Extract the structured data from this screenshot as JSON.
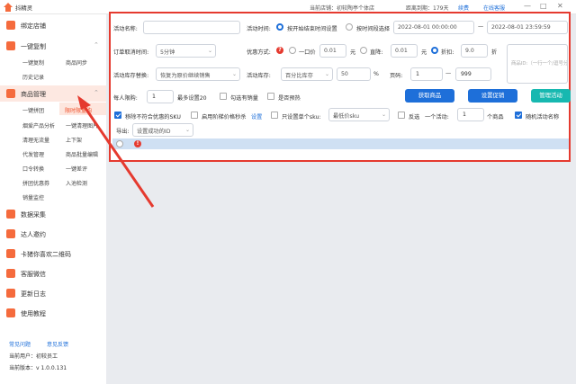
{
  "app": {
    "title": "抖精灵",
    "current_shop_label": "当前店铺：初较陶亭个体店",
    "expire_label": "距离到期：179天",
    "renew_link": "续费",
    "online_service": "在线客服",
    "win_min": "—",
    "win_max": "□",
    "win_close": "✕"
  },
  "sidebar": {
    "bind_shop": "绑定店铺",
    "copy_group": "一键复制",
    "copy_sub": [
      "一键复制",
      "商品同步",
      "历史记录"
    ],
    "goods_group": "商品管理",
    "goods_sub": [
      "一键拼团",
      "限时限量购",
      "烟爱产品分析",
      "一键清理图片",
      "清理无流量",
      "上下架",
      "代发管理",
      "商品批量编辑",
      "口令转换",
      "一键差评",
      "拼团优惠券",
      "入池检测",
      "销量监控"
    ],
    "data_collect": "数据采集",
    "invite": "达人邀约",
    "qrcode": "卡猪你喜欢二维码",
    "service": "客服微信",
    "changelog": "更新日志",
    "tutorial": "使用教程",
    "faq": "常见问题",
    "feedback": "意见反馈",
    "current_user": "当前用户：初较员工",
    "version": "当前版本：v 1.0.0.131"
  },
  "form": {
    "activity_name_label": "活动名称:",
    "activity_name_value": "",
    "activity_time_label": "活动时间:",
    "time_option1": "按开始结束时间设置",
    "time_option2": "按时间段选择",
    "start_time": "2022-08-01 00:00:00",
    "time_sep": "—",
    "end_time": "2022-08-01 23:59:59",
    "order_cancel_label": "订单取消时间:",
    "order_cancel_value": "5分钟",
    "discount_method_label": "优惠方式:",
    "one_price_label": "一口价",
    "one_price_value": "0.01",
    "yuan1": "元",
    "direct_down_label": "直降:",
    "direct_down_value": "0.01",
    "yuan2": "元",
    "discount_label": "折扣:",
    "discount_value": "9.0",
    "zhe": "折",
    "product_id_placeholder": "商品ID:（一行一个/逗号分隔）",
    "stock_label": "活动库存替换:",
    "stock_value": "恢复为原价继续销售",
    "activity_stock_label": "活动库存:",
    "activity_stock_value": "百分比库存",
    "percent_value": "50",
    "percent_unit": "%",
    "page_label": "页码:",
    "page_from": "1",
    "page_to": "999",
    "page_sep": "—",
    "limit_label": "每人限购:",
    "limit_value": "1",
    "limit_hint": "最多设置20",
    "check_sold_label": "勾选有销量",
    "presale_label": "是否预热",
    "btn_get_goods": "获取商品",
    "btn_set_promo": "设置促销",
    "btn_manage": "管理活动",
    "remove_sku_label": "移除不符合优惠的SKU",
    "tiered_label": "启用阶梯价格秒杀",
    "tiered_setting": "设置",
    "single_sku_label": "只设置单个sku:",
    "single_sku_value": "最低价sku",
    "invert_label": "反选",
    "per_activity_label": "一个活动:",
    "per_activity_value": "1",
    "per_activity_unit": "个商品",
    "random_name_label": "随机活动名称",
    "export_label": "导出:",
    "export_value": "设置成功的ID"
  },
  "colors": {
    "accent": "#1e6fd9",
    "brand": "#f56b3d",
    "highlight_border": "#e53a2f",
    "teal": "#17b8b0"
  }
}
